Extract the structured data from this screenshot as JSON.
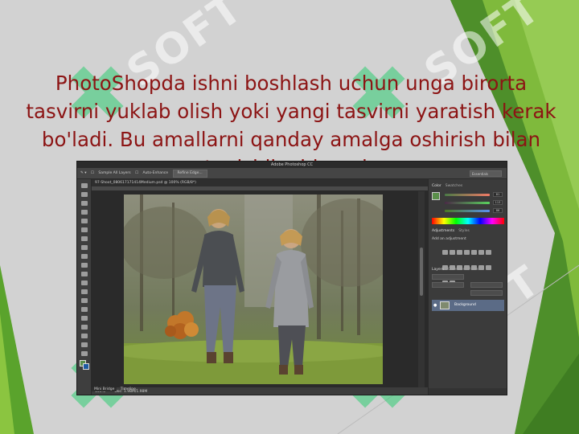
{
  "slide": {
    "title": "PhotoShopda ishni boshlash uchun unga birorta tasvirni yuklab olish yoki yangi tasvirni yaratish kerak bo'ladi. Bu amallarni qanday amalga oshirish bilan tanishib chiqamiz",
    "watermark": "SOFT",
    "colors": {
      "title": "#8c1414",
      "green_dark": "#4e8f2a",
      "green_light": "#8bc540",
      "background": "#d2d2d2"
    }
  },
  "photoshop": {
    "window_title": "Adobe Photoshop CC",
    "options_bar": {
      "sample_all_layers": "Sample All Layers",
      "auto_enhance": "Auto-Enhance",
      "refine_edge": "Refine Edge...",
      "workspace": "Essentials"
    },
    "document_tab": "97-Shoot_080617171414Medium.psd @ 100% (RGB/8*)",
    "status": {
      "zoom": "100%",
      "doc_size": "Doc: 1.98M/1.98M"
    },
    "bottom_tabs": [
      "Mini Bridge",
      "Timeline"
    ],
    "panels": {
      "color_tabs": [
        "Color",
        "Swatches"
      ],
      "color_values": [
        "81",
        "113",
        "86"
      ],
      "adjustments_tabs": [
        "Adjustments",
        "Styles"
      ],
      "adjustments_label": "Add an adjustment",
      "layers_tabs": [
        "Layers",
        "Channels",
        "Paths"
      ],
      "layer_name": "Background"
    }
  }
}
